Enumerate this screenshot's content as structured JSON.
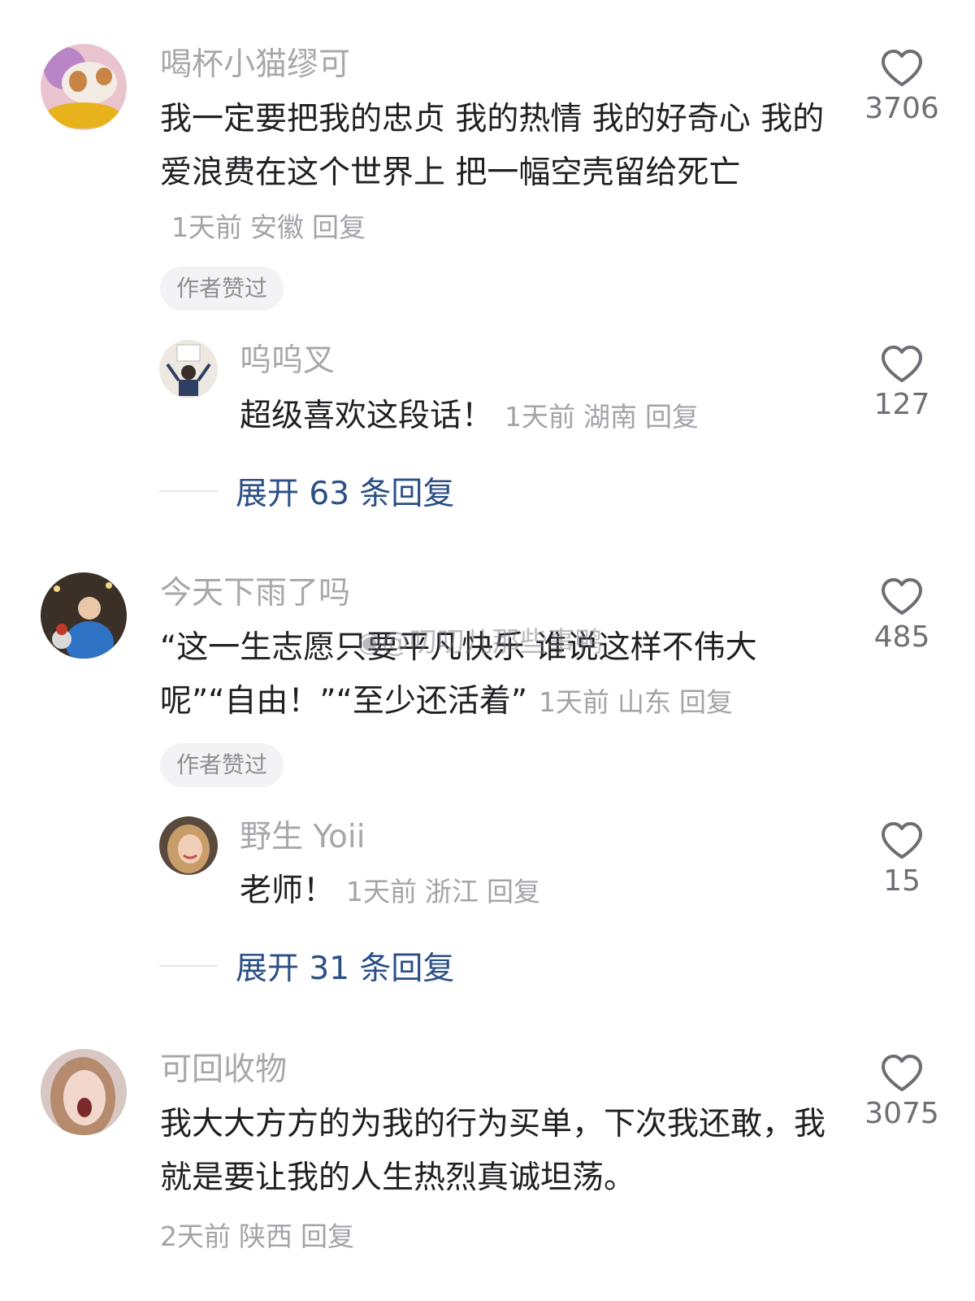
{
  "comments": [
    {
      "username": "喝杯小猫缪可",
      "text": "我一定要把我的忠贞 我的热情 我的好奇心 我的爱浪费在这个世界上 把一幅空壳留给死亡",
      "time": "1天前",
      "location": "安徽",
      "reply_label": "回复",
      "badge": "作者赞过",
      "likes": "3706",
      "reply": {
        "username": "呜呜叉",
        "text": "超级喜欢这段话！",
        "time": "1天前",
        "location": "湖南",
        "reply_label": "回复",
        "likes": "127"
      },
      "expand_label": "展开 63 条回复"
    },
    {
      "username": "今天下雨了吗",
      "text": "“这一生志愿只要平凡快乐 谁说这样不伟大呢”“自由！”“至少还活着”",
      "time": "1天前",
      "location": "山东",
      "reply_label": "回复",
      "badge": "作者赞过",
      "likes": "485",
      "reply": {
        "username": "野生 Yoii",
        "text": "老师！",
        "time": "1天前",
        "location": "浙江",
        "reply_label": "回复",
        "likes": "15"
      },
      "expand_label": "展开 31 条回复"
    },
    {
      "username": "可回收物",
      "text": "我大大方方的为我的行为买单，下次我还敢，我就是要让我的人生热烈真诚坦荡。",
      "time": "2天前",
      "location": "陕西",
      "reply_label": "回复",
      "likes": "3075"
    }
  ],
  "watermark": "@叨叨儿那些事鸭",
  "colors": {
    "name": "#a7a7ad",
    "meta": "#a3a3aa",
    "expand": "#2b4f86",
    "badge_bg": "#f3f3f5"
  },
  "icons": {
    "like": "heart-outline-icon",
    "watermark": "weibo-logo-icon"
  }
}
